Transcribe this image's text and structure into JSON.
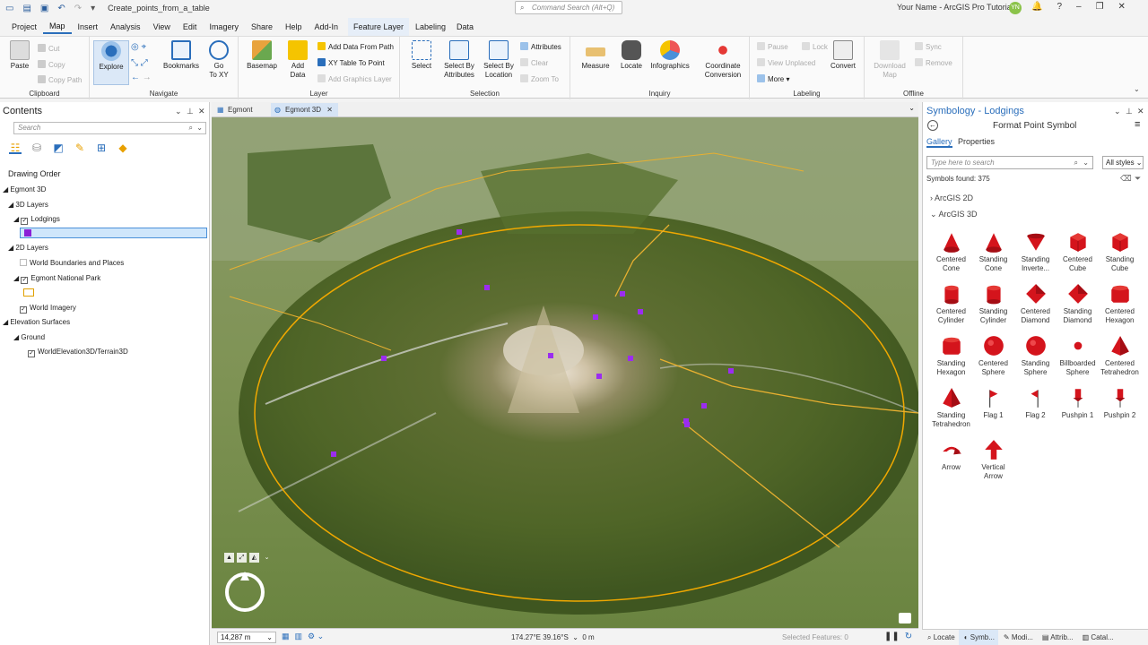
{
  "titlebar": {
    "file_name": "Create_points_from_a_table",
    "command_search_placeholder": "Command Search (Alt+Q)",
    "user": "Your Name - ArcGIS Pro Tutorials",
    "user_initials": "YN"
  },
  "tabs": [
    "Project",
    "Map",
    "Insert",
    "Analysis",
    "View",
    "Edit",
    "Imagery",
    "Share",
    "Help",
    "Add-In"
  ],
  "context_tabs": [
    "Feature Layer",
    "Labeling",
    "Data"
  ],
  "ribbon": {
    "clipboard": {
      "label": "Clipboard",
      "paste": "Paste",
      "cut": "Cut",
      "copy": "Copy",
      "copy_path": "Copy Path"
    },
    "navigate": {
      "label": "Navigate",
      "explore": "Explore",
      "bookmarks": "Bookmarks",
      "goto": "Go\nTo XY"
    },
    "layer": {
      "label": "Layer",
      "basemap": "Basemap",
      "add_data": "Add\nData",
      "add_from_path": "Add Data From Path",
      "xy_table": "XY Table To Point",
      "add_graphics": "Add Graphics Layer"
    },
    "selection": {
      "label": "Selection",
      "select": "Select",
      "by_attr": "Select By\nAttributes",
      "by_loc": "Select By\nLocation",
      "attributes": "Attributes",
      "clear": "Clear",
      "zoom_to": "Zoom To"
    },
    "inquiry": {
      "label": "Inquiry",
      "measure": "Measure",
      "locate": "Locate",
      "infographics": "Infographics",
      "coord": "Coordinate\nConversion"
    },
    "labeling": {
      "label": "Labeling",
      "pause": "Pause",
      "lock": "Lock",
      "view_unplaced": "View Unplaced",
      "more": "More",
      "convert": "Convert"
    },
    "offline": {
      "label": "Offline",
      "download": "Download\nMap",
      "sync": "Sync",
      "remove": "Remove"
    }
  },
  "contents": {
    "title": "Contents",
    "search_placeholder": "Search",
    "drawing_order": "Drawing Order",
    "tree": {
      "map3d": "Egmont 3D",
      "layers3d": "3D Layers",
      "lodgings": "Lodgings",
      "layers2d": "2D Layers",
      "world_boundaries": "World Boundaries and Places",
      "national_park": "Egmont National Park",
      "world_imagery": "World Imagery",
      "elevation": "Elevation Surfaces",
      "ground": "Ground",
      "terrain": "WorldElevation3D/Terrain3D"
    }
  },
  "map_tabs": [
    "Egmont",
    "Egmont 3D"
  ],
  "status": {
    "scale": "14,287 m",
    "coords": "174.27°E 39.16°S",
    "elev": "0 m",
    "selected": "Selected Features: 0"
  },
  "symbology": {
    "title": "Symbology - Lodgings",
    "subtitle": "Format Point Symbol",
    "tab_gallery": "Gallery",
    "tab_properties": "Properties",
    "search_placeholder": "Type here to search",
    "styles": "All styles",
    "found": "Symbols found: 375",
    "cat_2d": "ArcGIS 2D",
    "cat_3d": "ArcGIS 3D",
    "symbols": [
      {
        "label": "Centered Cone",
        "shape": "cone"
      },
      {
        "label": "Standing Cone",
        "shape": "cone"
      },
      {
        "label": "Standing Inverte...",
        "shape": "invcone"
      },
      {
        "label": "Centered Cube",
        "shape": "cube"
      },
      {
        "label": "Standing Cube",
        "shape": "cube"
      },
      {
        "label": "Centered Cylinder",
        "shape": "cylinder"
      },
      {
        "label": "Standing Cylinder",
        "shape": "cylinder"
      },
      {
        "label": "Centered Diamond",
        "shape": "diamond"
      },
      {
        "label": "Standing Diamond",
        "shape": "diamond"
      },
      {
        "label": "Centered Hexagon",
        "shape": "hexagon"
      },
      {
        "label": "Standing Hexagon",
        "shape": "hexagon"
      },
      {
        "label": "Centered Sphere",
        "shape": "sphere"
      },
      {
        "label": "Standing Sphere",
        "shape": "sphere"
      },
      {
        "label": "Billboarded Sphere",
        "shape": "smallsphere"
      },
      {
        "label": "Centered Tetrahedron",
        "shape": "tetra"
      },
      {
        "label": "Standing Tetrahedron",
        "shape": "tetra"
      },
      {
        "label": "Flag 1",
        "shape": "flag"
      },
      {
        "label": "Flag 2",
        "shape": "flag2"
      },
      {
        "label": "Pushpin 1",
        "shape": "pushpin"
      },
      {
        "label": "Pushpin 2",
        "shape": "pushpin"
      },
      {
        "label": "Arrow",
        "shape": "arrow"
      },
      {
        "label": "Vertical Arrow",
        "shape": "varrow"
      }
    ]
  },
  "pane_tabs": [
    "Locate",
    "Symb...",
    "Modi...",
    "Attrib...",
    "Catal..."
  ],
  "colors": {
    "accent": "#2a6ebb",
    "symbol_red": "#d4141c",
    "lodging_purple": "#9b2cf0",
    "park_boundary": "#f0a800"
  }
}
